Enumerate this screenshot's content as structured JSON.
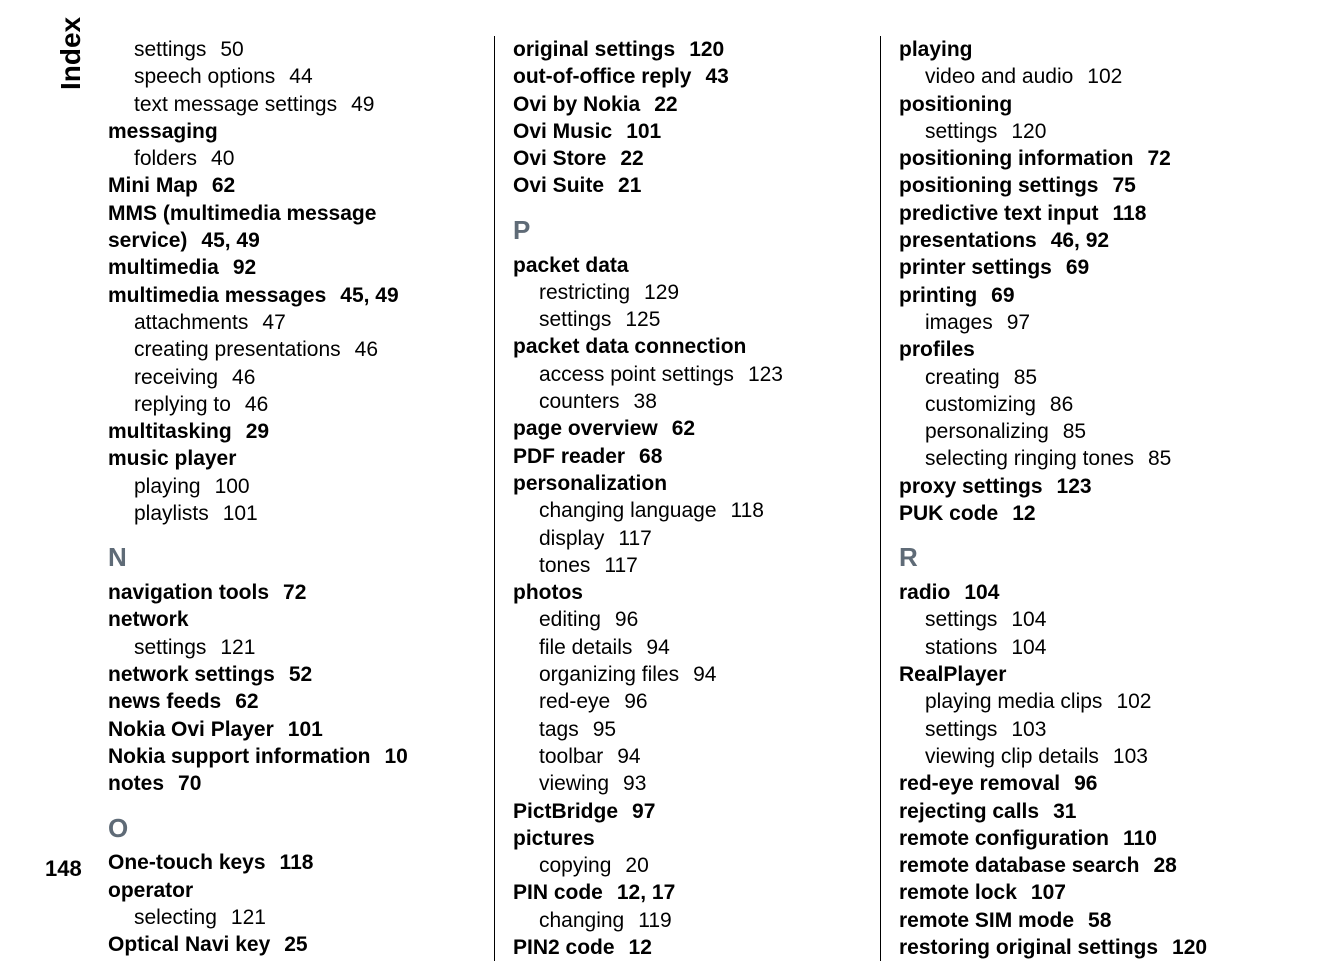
{
  "sideLabel": "Index",
  "pageNumber": "148",
  "columns": [
    [
      {
        "type": "sub",
        "text": "settings",
        "page": "50"
      },
      {
        "type": "sub",
        "text": "speech options",
        "page": "44"
      },
      {
        "type": "sub",
        "text": "text message settings",
        "page": "49"
      },
      {
        "type": "top",
        "text": "messaging",
        "page": ""
      },
      {
        "type": "sub",
        "text": "folders",
        "page": "40"
      },
      {
        "type": "top",
        "text": "Mini Map",
        "page": "62"
      },
      {
        "type": "top",
        "text": "MMS (multimedia message service)",
        "page": "45, 49"
      },
      {
        "type": "top",
        "text": "multimedia",
        "page": "92"
      },
      {
        "type": "top",
        "text": "multimedia messages",
        "page": "45, 49"
      },
      {
        "type": "sub",
        "text": "attachments",
        "page": "47"
      },
      {
        "type": "sub",
        "text": "creating presentations",
        "page": "46"
      },
      {
        "type": "sub",
        "text": "receiving",
        "page": "46"
      },
      {
        "type": "sub",
        "text": "replying to",
        "page": "46"
      },
      {
        "type": "top",
        "text": "multitasking",
        "page": "29"
      },
      {
        "type": "top",
        "text": "music player",
        "page": ""
      },
      {
        "type": "sub",
        "text": "playing",
        "page": "100"
      },
      {
        "type": "sub",
        "text": "playlists",
        "page": "101"
      },
      {
        "type": "letter",
        "text": "N"
      },
      {
        "type": "top",
        "text": "navigation tools",
        "page": "72"
      },
      {
        "type": "top",
        "text": "network",
        "page": ""
      },
      {
        "type": "sub",
        "text": "settings",
        "page": "121"
      },
      {
        "type": "top",
        "text": "network settings",
        "page": "52"
      },
      {
        "type": "top",
        "text": "news feeds",
        "page": "62"
      },
      {
        "type": "top",
        "text": "Nokia Ovi Player",
        "page": "101"
      },
      {
        "type": "top",
        "text": "Nokia support information",
        "page": "10"
      },
      {
        "type": "top",
        "text": "notes",
        "page": "70"
      },
      {
        "type": "letter",
        "text": "O"
      },
      {
        "type": "top",
        "text": "One-touch keys",
        "page": "118"
      },
      {
        "type": "top",
        "text": "operator",
        "page": ""
      },
      {
        "type": "sub",
        "text": "selecting",
        "page": "121"
      },
      {
        "type": "top",
        "text": "Optical Navi key",
        "page": "25"
      }
    ],
    [
      {
        "type": "top",
        "text": "original settings",
        "page": "120"
      },
      {
        "type": "top",
        "text": "out-of-office reply",
        "page": "43"
      },
      {
        "type": "top",
        "text": "Ovi by Nokia",
        "page": "22"
      },
      {
        "type": "top",
        "text": "Ovi Music",
        "page": "101"
      },
      {
        "type": "top",
        "text": "Ovi Store",
        "page": "22"
      },
      {
        "type": "top",
        "text": "Ovi Suite",
        "page": "21"
      },
      {
        "type": "letter",
        "text": "P"
      },
      {
        "type": "top",
        "text": "packet data",
        "page": ""
      },
      {
        "type": "sub",
        "text": "restricting",
        "page": "129"
      },
      {
        "type": "sub",
        "text": "settings",
        "page": "125"
      },
      {
        "type": "top",
        "text": "packet data connection",
        "page": ""
      },
      {
        "type": "sub",
        "text": "access point settings",
        "page": "123"
      },
      {
        "type": "sub",
        "text": "counters",
        "page": "38"
      },
      {
        "type": "top",
        "text": "page overview",
        "page": "62"
      },
      {
        "type": "top",
        "text": "PDF reader",
        "page": "68"
      },
      {
        "type": "top",
        "text": "personalization",
        "page": ""
      },
      {
        "type": "sub",
        "text": "changing language",
        "page": "118"
      },
      {
        "type": "sub",
        "text": "display",
        "page": "117"
      },
      {
        "type": "sub",
        "text": "tones",
        "page": "117"
      },
      {
        "type": "top",
        "text": "photos",
        "page": ""
      },
      {
        "type": "sub",
        "text": "editing",
        "page": "96"
      },
      {
        "type": "sub",
        "text": "file details",
        "page": "94"
      },
      {
        "type": "sub",
        "text": "organizing files",
        "page": "94"
      },
      {
        "type": "sub",
        "text": "red-eye",
        "page": "96"
      },
      {
        "type": "sub",
        "text": "tags",
        "page": "95"
      },
      {
        "type": "sub",
        "text": "toolbar",
        "page": "94"
      },
      {
        "type": "sub",
        "text": "viewing",
        "page": "93"
      },
      {
        "type": "top",
        "text": "PictBridge",
        "page": "97"
      },
      {
        "type": "top",
        "text": "pictures",
        "page": ""
      },
      {
        "type": "sub",
        "text": "copying",
        "page": "20"
      },
      {
        "type": "top",
        "text": "PIN code",
        "page": "12, 17"
      },
      {
        "type": "sub",
        "text": "changing",
        "page": "119"
      },
      {
        "type": "top",
        "text": "PIN2 code",
        "page": "12"
      }
    ],
    [
      {
        "type": "top",
        "text": "playing",
        "page": ""
      },
      {
        "type": "sub",
        "text": "video and audio",
        "page": "102"
      },
      {
        "type": "top",
        "text": "positioning",
        "page": ""
      },
      {
        "type": "sub",
        "text": "settings",
        "page": "120"
      },
      {
        "type": "top",
        "text": "positioning information",
        "page": "72"
      },
      {
        "type": "top",
        "text": "positioning settings",
        "page": "75"
      },
      {
        "type": "top",
        "text": "predictive text input",
        "page": "118"
      },
      {
        "type": "top",
        "text": "presentations",
        "page": "46, 92"
      },
      {
        "type": "top",
        "text": "printer settings",
        "page": "69"
      },
      {
        "type": "top",
        "text": "printing",
        "page": "69"
      },
      {
        "type": "sub",
        "text": "images",
        "page": "97"
      },
      {
        "type": "top",
        "text": "profiles",
        "page": ""
      },
      {
        "type": "sub",
        "text": "creating",
        "page": "85"
      },
      {
        "type": "sub",
        "text": "customizing",
        "page": "86"
      },
      {
        "type": "sub",
        "text": "personalizing",
        "page": "85"
      },
      {
        "type": "sub",
        "text": "selecting ringing tones",
        "page": "85"
      },
      {
        "type": "top",
        "text": "proxy settings",
        "page": "123"
      },
      {
        "type": "top",
        "text": "PUK code",
        "page": "12"
      },
      {
        "type": "letter",
        "text": "R"
      },
      {
        "type": "top",
        "text": "radio",
        "page": "104"
      },
      {
        "type": "sub",
        "text": "settings",
        "page": "104"
      },
      {
        "type": "sub",
        "text": "stations",
        "page": "104"
      },
      {
        "type": "top",
        "text": "RealPlayer",
        "page": ""
      },
      {
        "type": "sub",
        "text": "playing media clips",
        "page": "102"
      },
      {
        "type": "sub",
        "text": "settings",
        "page": "103"
      },
      {
        "type": "sub",
        "text": "viewing clip details",
        "page": "103"
      },
      {
        "type": "top",
        "text": "red-eye removal",
        "page": "96"
      },
      {
        "type": "top",
        "text": "rejecting calls",
        "page": "31"
      },
      {
        "type": "top",
        "text": "remote configuration",
        "page": "110"
      },
      {
        "type": "top",
        "text": "remote database search",
        "page": "28"
      },
      {
        "type": "top",
        "text": "remote lock",
        "page": "107"
      },
      {
        "type": "top",
        "text": "remote SIM mode",
        "page": "58"
      },
      {
        "type": "top",
        "text": "restoring original settings",
        "page": "120"
      }
    ]
  ]
}
